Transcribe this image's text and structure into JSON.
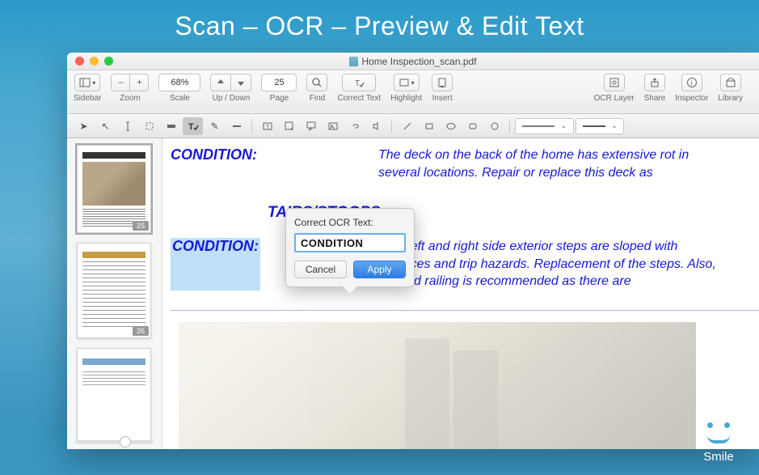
{
  "promo": {
    "title": "Scan – OCR – Preview & Edit Text"
  },
  "window": {
    "title": "Home Inspection_scan.pdf"
  },
  "toolbar": {
    "sidebar_label": "Sidebar",
    "zoom_label": "Zoom",
    "zoom_minus": "–",
    "zoom_plus": "+",
    "scale_label": "Scale",
    "scale_value": "68%",
    "updown_label": "Up / Down",
    "page_label": "Page",
    "page_value": "25",
    "find_label": "Find",
    "correct_label": "Correct Text",
    "highlight_label": "Highlight",
    "insert_label": "Insert",
    "ocr_label": "OCR Layer",
    "share_label": "Share",
    "inspector_label": "Inspector",
    "library_label": "Library"
  },
  "thumbs": {
    "p1": "25",
    "p2": "26"
  },
  "doc": {
    "cond": "CONDITION:",
    "deck_text": "The deck on the back of the home has extensive rot in several locations. Repair or replace this deck as",
    "section": "TAIRS/STOOPS::",
    "steps_text": "The left and right side exterior steps are sloped with surfaces and trip hazards. Replacement of the steps. Also, a hand railing is recommended as there are"
  },
  "popover": {
    "label": "Correct OCR Text:",
    "value": "CONDITION",
    "cancel": "Cancel",
    "apply": "Apply"
  },
  "brand": {
    "name": "Smile"
  }
}
